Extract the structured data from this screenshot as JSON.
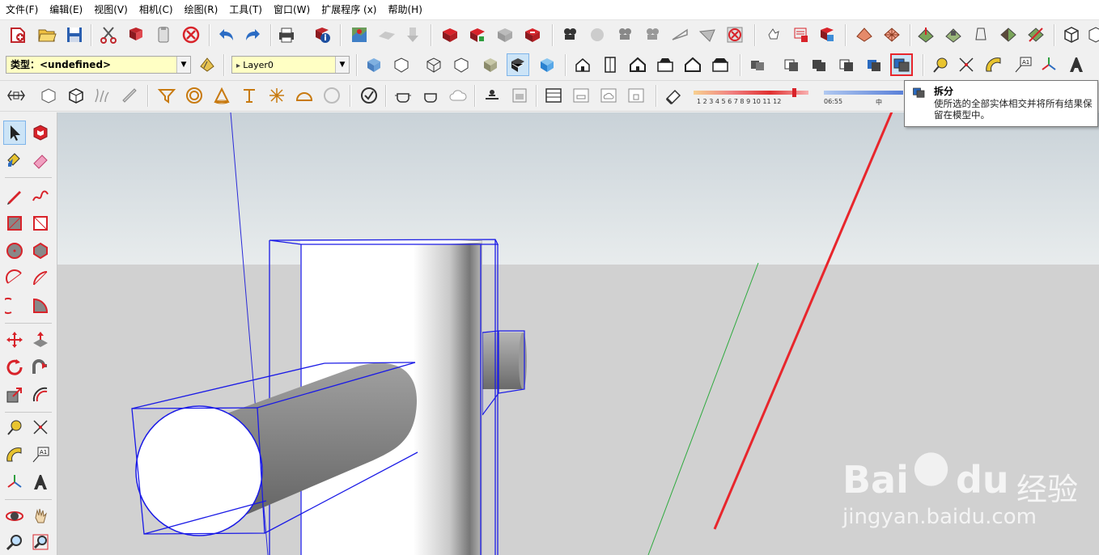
{
  "menubar": {
    "items": [
      "文件(F)",
      "编辑(E)",
      "视图(V)",
      "相机(C)",
      "绘图(R)",
      "工具(T)",
      "窗口(W)",
      "扩展程序 (x)",
      "帮助(H)"
    ]
  },
  "layer_toolbar": {
    "type_label": "类型：<undefined>",
    "layer_name": "Layer0"
  },
  "shadow_toolbar": {
    "month_ticks": "1  2  3  4  5  6  7  8  9  10 11 12",
    "time_start": "06:55",
    "time_mid": "中"
  },
  "tooltip": {
    "title": "拆分",
    "description": "使所选的全部实体相交并将所有结果保留在模型中。"
  },
  "watermark": {
    "brand": "Bai",
    "brand2": "du",
    "suffix": "经验",
    "url": "jingyan.baidu.com"
  },
  "colors": {
    "highlight": "#e8262c",
    "selection": "#1a1ae6",
    "sky": "#dfe6ea",
    "ground": "#d1d1d1"
  }
}
